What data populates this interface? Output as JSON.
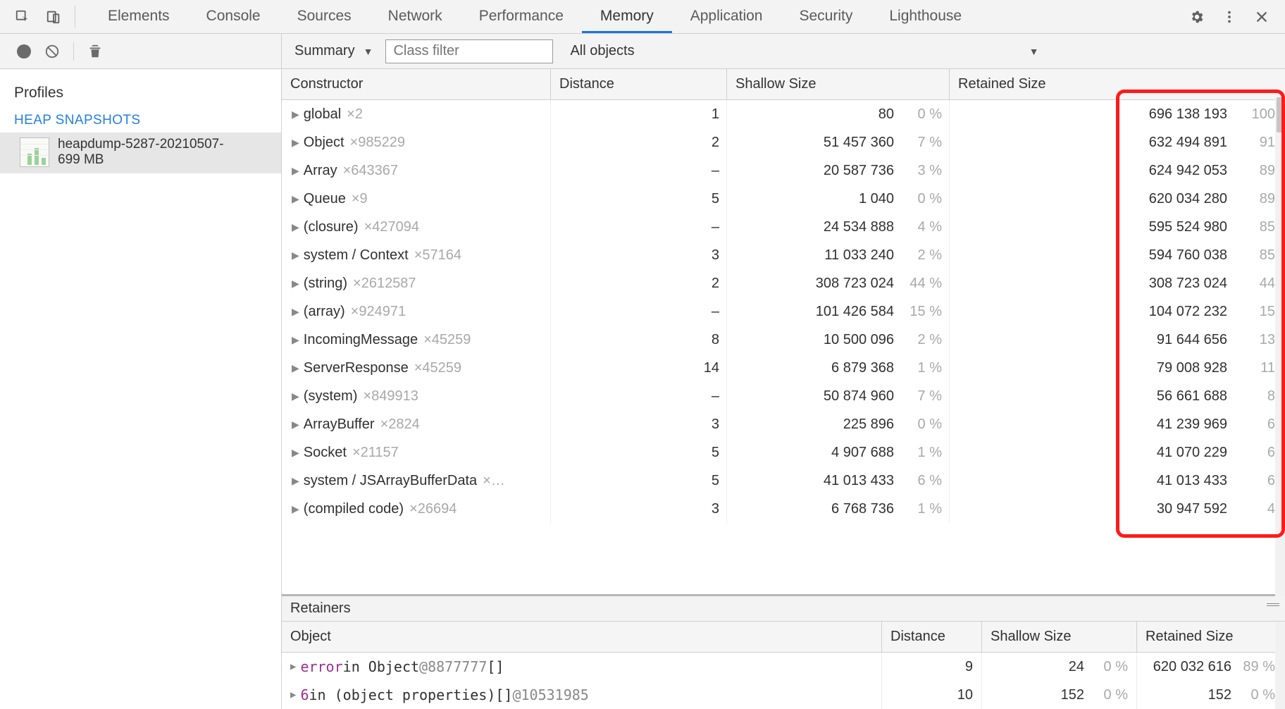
{
  "topTabs": {
    "items": [
      "Elements",
      "Console",
      "Sources",
      "Network",
      "Performance",
      "Memory",
      "Application",
      "Security",
      "Lighthouse"
    ],
    "activeIndex": 5
  },
  "filterbar": {
    "view": "Summary",
    "classFilterPlaceholder": "Class filter",
    "objectsLabel": "All objects"
  },
  "sidebar": {
    "paneTitle": "Profiles",
    "sectionTitle": "HEAP SNAPSHOTS",
    "snapshotLabel": "heapdump-5287-20210507-",
    "snapshotSize": "699 MB"
  },
  "columns": {
    "constructor": "Constructor",
    "distance": "Distance",
    "shallow": "Shallow Size",
    "retained": "Retained Size"
  },
  "rows": [
    {
      "name": "global",
      "count": "×2",
      "distance": "1",
      "shallow": "80",
      "shallowPct": "0 %",
      "retained": "696 138 193",
      "retainedPct": "100"
    },
    {
      "name": "Object",
      "count": "×985229",
      "distance": "2",
      "shallow": "51 457 360",
      "shallowPct": "7 %",
      "retained": "632 494 891",
      "retainedPct": "91"
    },
    {
      "name": "Array",
      "count": "×643367",
      "distance": "–",
      "shallow": "20 587 736",
      "shallowPct": "3 %",
      "retained": "624 942 053",
      "retainedPct": "89"
    },
    {
      "name": "Queue",
      "count": "×9",
      "distance": "5",
      "shallow": "1 040",
      "shallowPct": "0 %",
      "retained": "620 034 280",
      "retainedPct": "89"
    },
    {
      "name": "(closure)",
      "count": "×427094",
      "distance": "–",
      "shallow": "24 534 888",
      "shallowPct": "4 %",
      "retained": "595 524 980",
      "retainedPct": "85"
    },
    {
      "name": "system / Context",
      "count": "×57164",
      "distance": "3",
      "shallow": "11 033 240",
      "shallowPct": "2 %",
      "retained": "594 760 038",
      "retainedPct": "85"
    },
    {
      "name": "(string)",
      "count": "×2612587",
      "distance": "2",
      "shallow": "308 723 024",
      "shallowPct": "44 %",
      "retained": "308 723 024",
      "retainedPct": "44"
    },
    {
      "name": "(array)",
      "count": "×924971",
      "distance": "–",
      "shallow": "101 426 584",
      "shallowPct": "15 %",
      "retained": "104 072 232",
      "retainedPct": "15"
    },
    {
      "name": "IncomingMessage",
      "count": "×45259",
      "distance": "8",
      "shallow": "10 500 096",
      "shallowPct": "2 %",
      "retained": "91 644 656",
      "retainedPct": "13"
    },
    {
      "name": "ServerResponse",
      "count": "×45259",
      "distance": "14",
      "shallow": "6 879 368",
      "shallowPct": "1 %",
      "retained": "79 008 928",
      "retainedPct": "11"
    },
    {
      "name": "(system)",
      "count": "×849913",
      "distance": "–",
      "shallow": "50 874 960",
      "shallowPct": "7 %",
      "retained": "56 661 688",
      "retainedPct": "8"
    },
    {
      "name": "ArrayBuffer",
      "count": "×2824",
      "distance": "3",
      "shallow": "225 896",
      "shallowPct": "0 %",
      "retained": "41 239 969",
      "retainedPct": "6"
    },
    {
      "name": "Socket",
      "count": "×21157",
      "distance": "5",
      "shallow": "4 907 688",
      "shallowPct": "1 %",
      "retained": "41 070 229",
      "retainedPct": "6"
    },
    {
      "name": "system / JSArrayBufferData",
      "count": "×…",
      "distance": "5",
      "shallow": "41 013 433",
      "shallowPct": "6 %",
      "retained": "41 013 433",
      "retainedPct": "6"
    },
    {
      "name": "(compiled code)",
      "count": "×26694",
      "distance": "3",
      "shallow": "6 768 736",
      "shallowPct": "1 %",
      "retained": "30 947 592",
      "retainedPct": "4"
    }
  ],
  "retainers": {
    "title": "Retainers",
    "columns": {
      "object": "Object",
      "distance": "Distance",
      "shallow": "Shallow Size",
      "retained": "Retained Size"
    },
    "rows": [
      {
        "objHtmlParts": {
          "key": "error",
          "mid": " in Object ",
          "ref": "@8877777",
          "tail": " []"
        },
        "distance": "9",
        "shallow": "24",
        "shallowPct": "0 %",
        "retained": "620 032 616",
        "retainedPct": "89 %"
      },
      {
        "objHtmlParts": {
          "key": "6",
          "mid": " in (object properties)[] ",
          "ref": "@10531985",
          "tail": ""
        },
        "distance": "10",
        "shallow": "152",
        "shallowPct": "0 %",
        "retained": "152",
        "retainedPct": "0 %"
      }
    ]
  }
}
